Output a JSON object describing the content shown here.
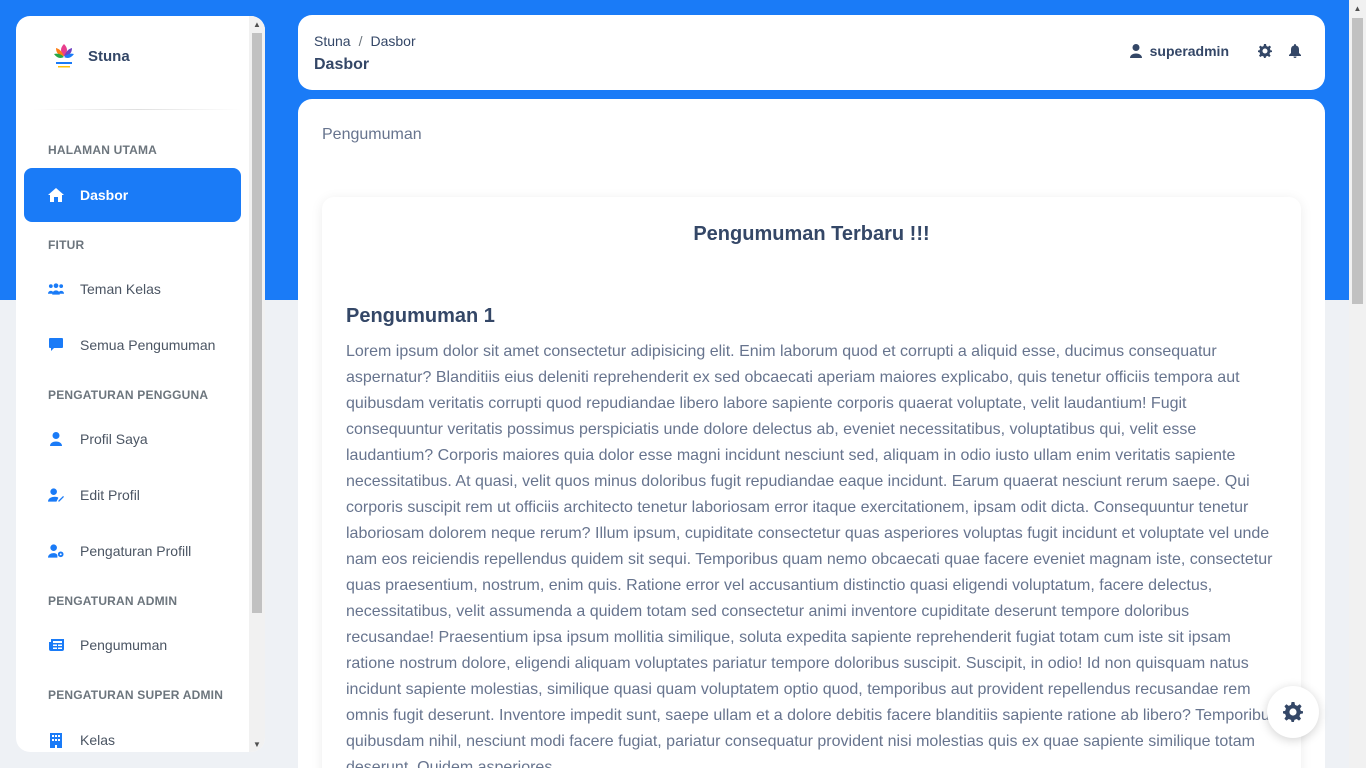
{
  "brand": {
    "name": "Stuna"
  },
  "sidebar": {
    "sections": {
      "main": "HALAMAN UTAMA",
      "features": "FITUR",
      "user_settings": "PENGATURAN PENGGUNA",
      "admin_settings": "PENGATURAN ADMIN",
      "super_admin_settings": "PENGATURAN SUPER ADMIN"
    },
    "items": {
      "dashboard": "Dasbor",
      "classmates": "Teman Kelas",
      "all_announcements": "Semua Pengumuman",
      "my_profile": "Profil Saya",
      "edit_profile": "Edit Profil",
      "profile_settings": "Pengaturan Profill",
      "announcements": "Pengumuman",
      "classes": "Kelas"
    }
  },
  "header": {
    "breadcrumb_root": "Stuna",
    "breadcrumb_sep": "/",
    "breadcrumb_current": "Dasbor",
    "title": "Dasbor",
    "username": "superadmin"
  },
  "main": {
    "heading": "Pengumuman",
    "card_title": "Pengumuman Terbaru !!!",
    "announcement": {
      "title": "Pengumuman 1",
      "body": "Lorem ipsum dolor sit amet consectetur adipisicing elit. Enim laborum quod et corrupti a aliquid esse, ducimus consequatur aspernatur? Blanditiis eius deleniti reprehenderit ex sed obcaecati aperiam maiores explicabo, quis tenetur officiis tempora aut quibusdam veritatis corrupti quod repudiandae libero labore sapiente corporis quaerat voluptate, velit laudantium! Fugit consequuntur veritatis possimus perspiciatis unde dolore delectus ab, eveniet necessitatibus, voluptatibus qui, velit esse laudantium? Corporis maiores quia dolor esse magni incidunt nesciunt sed, aliquam in odio iusto ullam enim veritatis sapiente necessitatibus. At quasi, velit quos minus doloribus fugit repudiandae eaque incidunt. Earum quaerat nesciunt rerum saepe. Qui corporis suscipit rem ut officiis architecto tenetur laboriosam error itaque exercitationem, ipsam odit dicta. Consequuntur tenetur laboriosam dolorem neque rerum? Illum ipsum, cupiditate consectetur quas asperiores voluptas fugit incidunt et voluptate vel unde nam eos reiciendis repellendus quidem sit sequi. Temporibus quam nemo obcaecati quae facere eveniet magnam iste, consectetur quas praesentium, nostrum, enim quis. Ratione error vel accusantium distinctio quasi eligendi voluptatum, facere delectus, necessitatibus, velit assumenda a quidem totam sed consectetur animi inventore cupiditate deserunt tempore doloribus recusandae! Praesentium ipsa ipsum mollitia similique, soluta expedita sapiente reprehenderit fugiat totam cum iste sit ipsam ratione nostrum dolore, eligendi aliquam voluptates pariatur tempore doloribus suscipit. Suscipit, in odio! Id non quisquam natus incidunt sapiente molestias, similique quasi quam voluptatem optio quod, temporibus aut provident repellendus recusandae rem omnis fugit deserunt. Inventore impedit sunt, saepe ullam et a dolore debitis facere blanditiis sapiente ratione ab libero? Temporibus quibusdam nihil, nesciunt modi facere fugiat, pariatur consequatur provident nisi molestias quis ex quae sapiente similique totam deserunt. Quidem asperiores"
    }
  },
  "colors": {
    "primary": "#1a7bf7",
    "text_dark": "#344767",
    "text_muted": "#67748e",
    "background": "#eef1f5"
  },
  "icons": {
    "brand_logo": "stuna-logo",
    "dashboard": "home-icon",
    "classmates": "users-icon",
    "all_announcements": "comment-icon",
    "my_profile": "user-icon",
    "edit_profile": "user-edit-icon",
    "profile_settings": "user-cog-icon",
    "announcements": "newspaper-icon",
    "classes": "building-icon",
    "user": "user-icon",
    "settings": "gear-icon",
    "notifications": "bell-icon"
  }
}
